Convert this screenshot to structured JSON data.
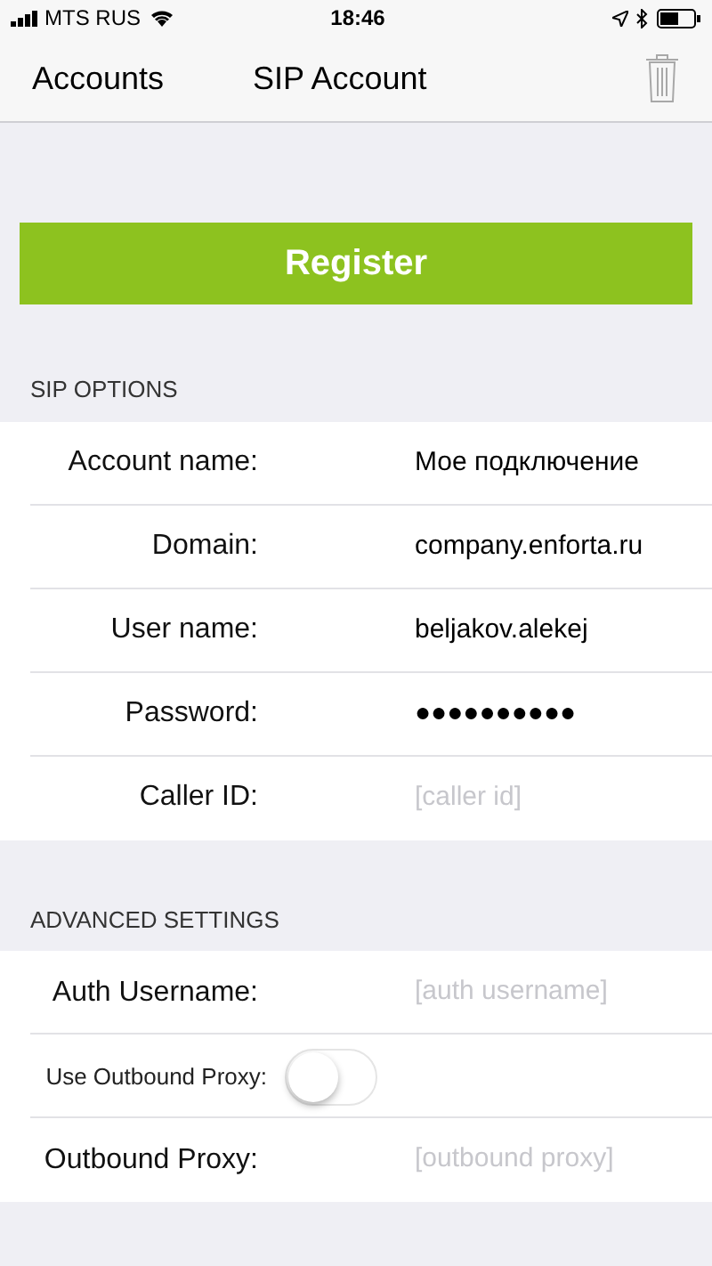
{
  "status_bar": {
    "carrier": "MTS RUS",
    "time": "18:46"
  },
  "nav": {
    "back": "Accounts",
    "title": "SIP Account"
  },
  "register_button": "Register",
  "sections": [
    {
      "header": "SIP OPTIONS",
      "rows": [
        {
          "kind": "text",
          "label": "Account name:",
          "value": "Мое подключение"
        },
        {
          "kind": "text",
          "label": "Domain:",
          "value": "company.enforta.ru"
        },
        {
          "kind": "text",
          "label": "User name:",
          "value": "beljakov.alekej"
        },
        {
          "kind": "text",
          "label": "Password:",
          "value": "●●●●●●●●●●"
        },
        {
          "kind": "text",
          "label": "Caller ID:",
          "placeholder": "[caller id]"
        }
      ]
    },
    {
      "header": "ADVANCED SETTINGS",
      "rows": [
        {
          "kind": "text",
          "label": "Auth Username:",
          "placeholder": "[auth username]"
        },
        {
          "kind": "toggle",
          "label": "Use Outbound Proxy:",
          "on": false
        },
        {
          "kind": "text",
          "label": "Outbound Proxy:",
          "placeholder": "[outbound proxy]"
        }
      ]
    }
  ]
}
